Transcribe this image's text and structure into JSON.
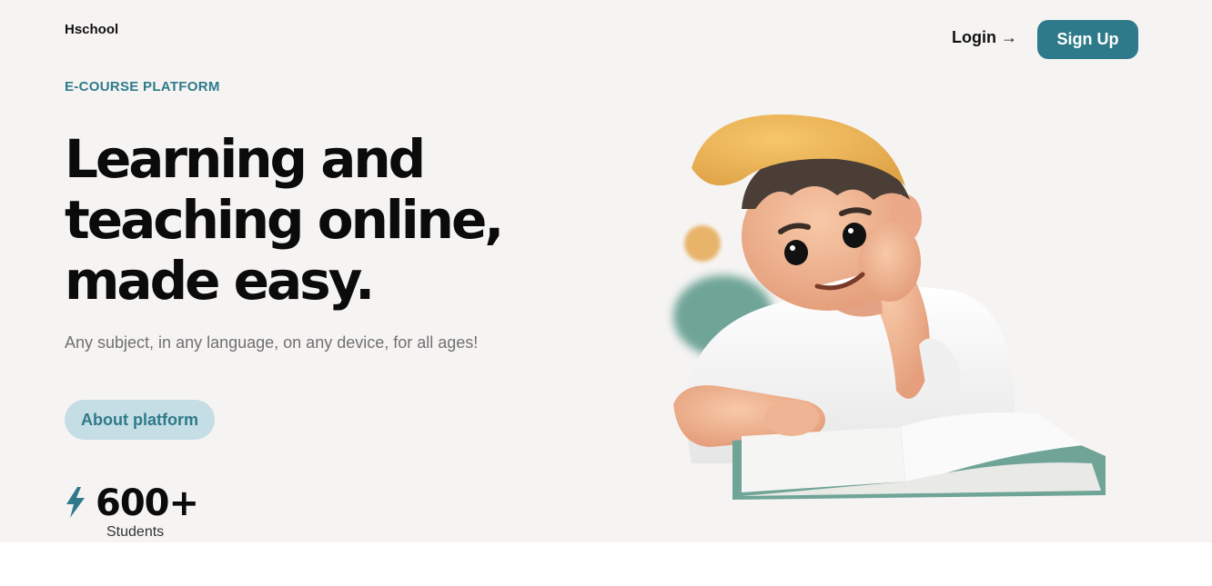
{
  "header": {
    "logo": "Hschool",
    "login_label": "Login →",
    "signup_label": "Sign Up"
  },
  "hero": {
    "eyebrow": "E-COURSE PLATFORM",
    "headline_lines": [
      "Learning and",
      "teaching online,",
      "made easy."
    ],
    "subtitle": "Any subject, in any language, on any device, for all ages!",
    "about_label": "About platform",
    "stat_value": "600+",
    "stat_label": "Students"
  },
  "colors": {
    "accent": "#2f7a8a",
    "accent_light": "#c5dde4",
    "background": "#f6f4f3"
  },
  "icons": {
    "stat": "lightning-bolt-icon"
  }
}
